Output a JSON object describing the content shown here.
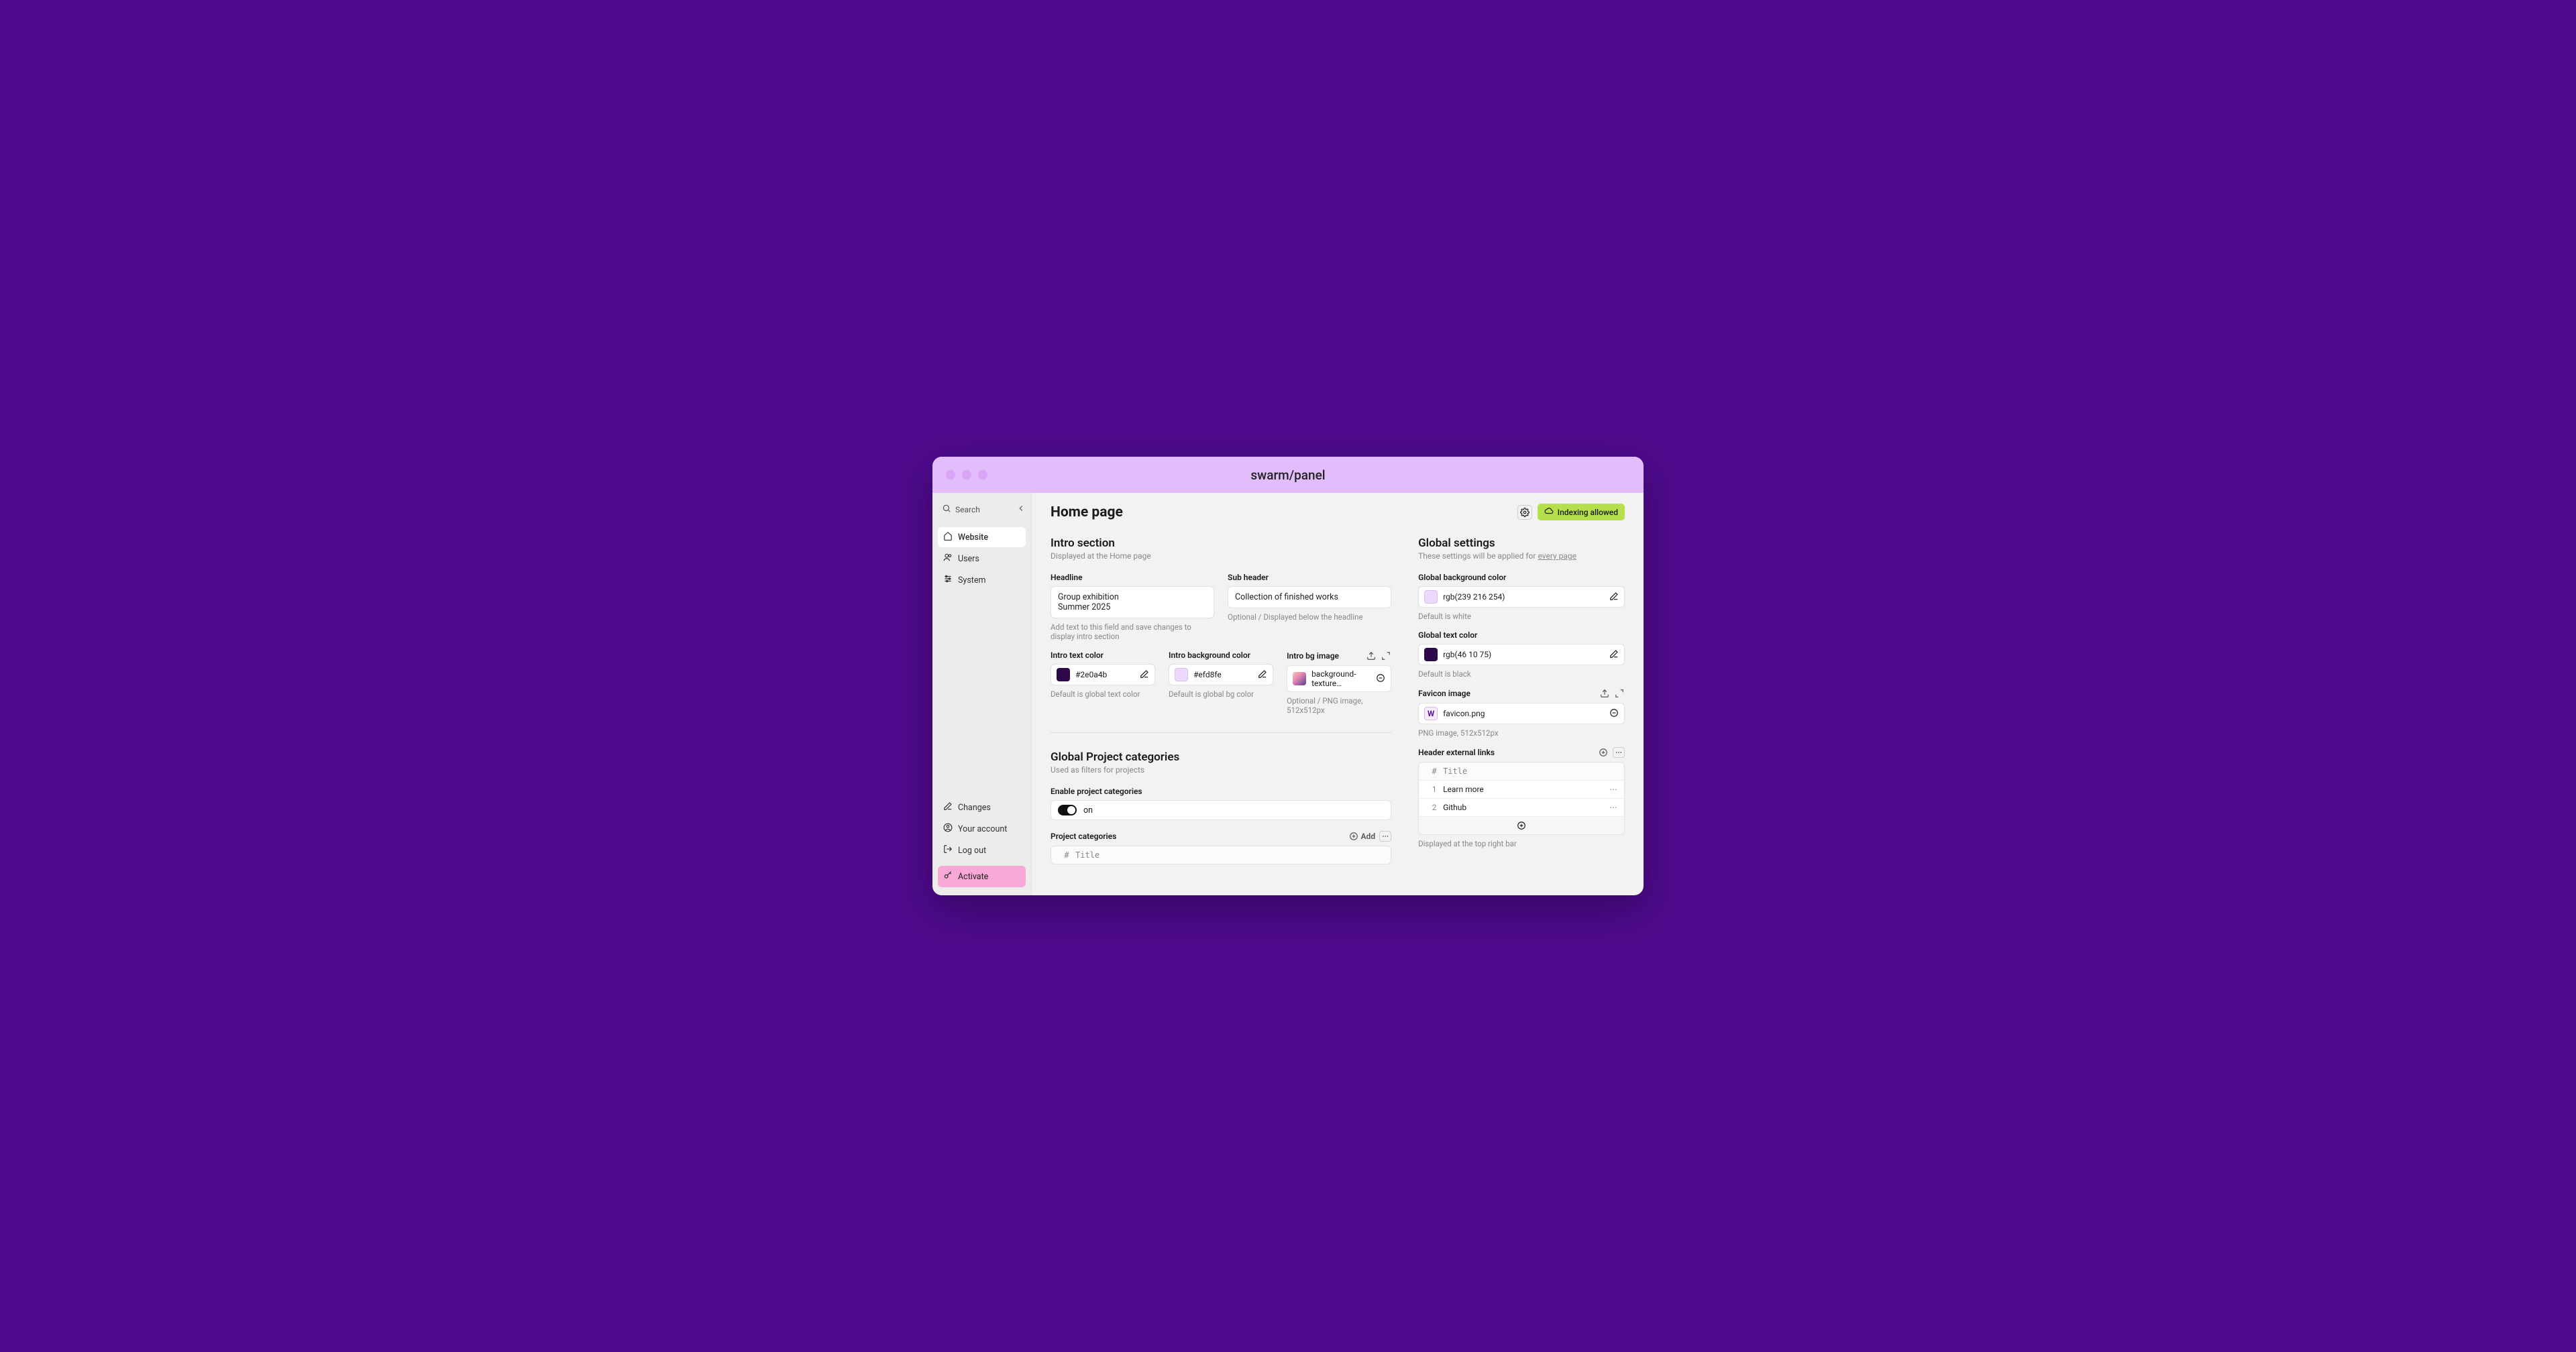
{
  "titlebar": {
    "title": "swarm/panel"
  },
  "sidebar": {
    "search_placeholder": "Search",
    "nav": [
      {
        "label": "Website",
        "icon": "home-icon",
        "active": true
      },
      {
        "label": "Users",
        "icon": "users-icon",
        "active": false
      },
      {
        "label": "System",
        "icon": "sliders-icon",
        "active": false
      }
    ],
    "bottom": [
      {
        "label": "Changes",
        "icon": "pencil-icon"
      },
      {
        "label": "Your account",
        "icon": "user-circle-icon"
      },
      {
        "label": "Log out",
        "icon": "logout-icon"
      }
    ],
    "activate_label": "Activate"
  },
  "header": {
    "title": "Home page",
    "badge_label": "Indexing allowed"
  },
  "intro": {
    "title": "Intro section",
    "subtitle": "Displayed at the Home page",
    "headline_label": "Headline",
    "headline_value": "Group exhibition\nSummer 2025",
    "headline_helper": "Add text to this field and save changes to display intro section",
    "subheader_label": "Sub header",
    "subheader_value": "Collection of finished works",
    "subheader_helper": "Optional / Displayed below the headline",
    "text_color": {
      "label": "Intro text color",
      "value": "#2e0a4b",
      "swatch": "#2e0a4b",
      "helper": "Default is global text color"
    },
    "bg_color": {
      "label": "Intro background color",
      "value": "#efd8fe",
      "swatch": "#efd8fe",
      "helper": "Default is global bg color"
    },
    "bg_image": {
      "label": "Intro bg image",
      "value": "background-texture…",
      "helper": "Optional / PNG image, 512x512px"
    }
  },
  "categories": {
    "title": "Global Project categories",
    "subtitle": "Used as filters for projects",
    "enable_label": "Enable project categories",
    "toggle_value": "on",
    "table_label": "Project categories",
    "add_label": "Add",
    "col_index": "#",
    "col_title": "Title"
  },
  "global": {
    "title": "Global settings",
    "subtitle_prefix": "These settings will be applied for ",
    "subtitle_emph": "every page",
    "bg_color": {
      "label": "Global background color",
      "value": "rgb(239 216 254)",
      "swatch": "#efd8fe",
      "helper": "Default is white"
    },
    "text_color": {
      "label": "Global text color",
      "value": "rgb(46 10 75)",
      "swatch": "#2e0a4b",
      "helper": "Default is black"
    },
    "favicon": {
      "label": "Favicon image",
      "value": "favicon.png",
      "helper": "PNG image, 512x512px"
    },
    "links": {
      "label": "Header external links",
      "col_index": "#",
      "col_title": "Title",
      "rows": [
        {
          "idx": "1",
          "title": "Learn more"
        },
        {
          "idx": "2",
          "title": "Github"
        }
      ],
      "helper": "Displayed at the top right bar"
    }
  }
}
